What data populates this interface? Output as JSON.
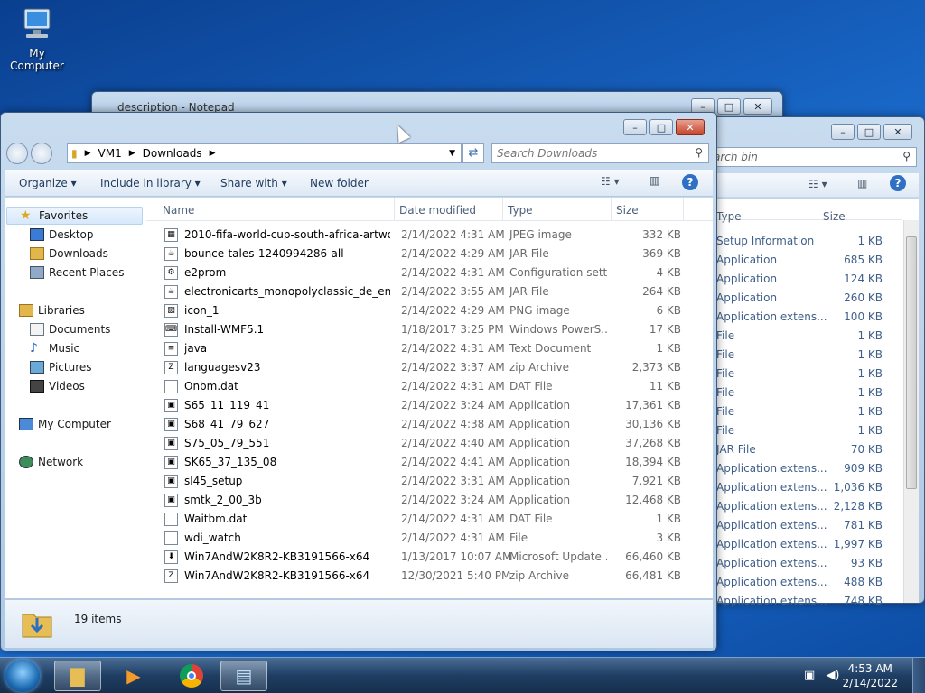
{
  "desktop": {
    "icon_label": "My Computer"
  },
  "notepad": {
    "title": "description - Notepad"
  },
  "bin_window": {
    "search_placeholder": "arch bin",
    "col_type": "Type",
    "col_size": "Size",
    "rows": [
      {
        "type": "Setup Information",
        "size": "1 KB"
      },
      {
        "type": "Application",
        "size": "685 KB"
      },
      {
        "type": "Application",
        "size": "124 KB"
      },
      {
        "type": "Application",
        "size": "260 KB"
      },
      {
        "type": "Application extens...",
        "size": "100 KB"
      },
      {
        "type": "File",
        "size": "1 KB"
      },
      {
        "type": "File",
        "size": "1 KB"
      },
      {
        "type": "File",
        "size": "1 KB"
      },
      {
        "type": "File",
        "size": "1 KB"
      },
      {
        "type": "File",
        "size": "1 KB"
      },
      {
        "type": "File",
        "size": "1 KB"
      },
      {
        "type": "JAR File",
        "size": "70 KB"
      },
      {
        "type": "Application extens...",
        "size": "909 KB"
      },
      {
        "type": "Application extens...",
        "size": "1,036 KB"
      },
      {
        "type": "Application extens...",
        "size": "2,128 KB"
      },
      {
        "type": "Application extens...",
        "size": "781 KB"
      },
      {
        "type": "Application extens...",
        "size": "1,997 KB"
      },
      {
        "type": "Application extens...",
        "size": "93 KB"
      },
      {
        "type": "Application extens...",
        "size": "488 KB"
      },
      {
        "type": "Application extens...",
        "size": "748 KB"
      }
    ]
  },
  "explorer": {
    "breadcrumb": [
      "VM1",
      "Downloads"
    ],
    "search_placeholder": "Search Downloads",
    "toolbar": {
      "organize": "Organize",
      "include": "Include in library",
      "share": "Share with",
      "new_folder": "New folder"
    },
    "columns": {
      "name": "Name",
      "date": "Date modified",
      "type": "Type",
      "size": "Size"
    },
    "nav": {
      "favorites": "Favorites",
      "desktop": "Desktop",
      "downloads": "Downloads",
      "recent": "Recent Places",
      "libraries": "Libraries",
      "documents": "Documents",
      "music": "Music",
      "pictures": "Pictures",
      "videos": "Videos",
      "computer": "My Computer",
      "network": "Network"
    },
    "files": [
      {
        "name": "2010-fifa-world-cup-south-africa-artwor...",
        "date": "2/14/2022 4:31 AM",
        "type": "JPEG image",
        "size": "332 KB",
        "icon": "image-icon"
      },
      {
        "name": "bounce-tales-1240994286-all",
        "date": "2/14/2022 4:29 AM",
        "type": "JAR File",
        "size": "369 KB",
        "icon": "jar-icon"
      },
      {
        "name": "e2prom",
        "date": "2/14/2022 4:31 AM",
        "type": "Configuration sett...",
        "size": "4 KB",
        "icon": "config-icon"
      },
      {
        "name": "electronicarts_monopolyclassic_de_en_es...",
        "date": "2/14/2022 3:55 AM",
        "type": "JAR File",
        "size": "264 KB",
        "icon": "jar-icon"
      },
      {
        "name": "icon_1",
        "date": "2/14/2022 4:29 AM",
        "type": "PNG image",
        "size": "6 KB",
        "icon": "png-icon"
      },
      {
        "name": "Install-WMF5.1",
        "date": "1/18/2017 3:25 PM",
        "type": "Windows PowerS...",
        "size": "17 KB",
        "icon": "script-icon"
      },
      {
        "name": "java",
        "date": "2/14/2022 4:31 AM",
        "type": "Text Document",
        "size": "1 KB",
        "icon": "text-icon"
      },
      {
        "name": "languagesv23",
        "date": "2/14/2022 3:37 AM",
        "type": "zip Archive",
        "size": "2,373 KB",
        "icon": "zip-icon"
      },
      {
        "name": "Onbm.dat",
        "date": "2/14/2022 4:31 AM",
        "type": "DAT File",
        "size": "11 KB",
        "icon": "file-icon"
      },
      {
        "name": "S65_11_119_41",
        "date": "2/14/2022 3:24 AM",
        "type": "Application",
        "size": "17,361 KB",
        "icon": "app-icon"
      },
      {
        "name": "S68_41_79_627",
        "date": "2/14/2022 4:38 AM",
        "type": "Application",
        "size": "30,136 KB",
        "icon": "app-icon"
      },
      {
        "name": "S75_05_79_551",
        "date": "2/14/2022 4:40 AM",
        "type": "Application",
        "size": "37,268 KB",
        "icon": "app-icon"
      },
      {
        "name": "SK65_37_135_08",
        "date": "2/14/2022 4:41 AM",
        "type": "Application",
        "size": "18,394 KB",
        "icon": "app-icon"
      },
      {
        "name": "sl45_setup",
        "date": "2/14/2022 3:31 AM",
        "type": "Application",
        "size": "7,921 KB",
        "icon": "app-icon"
      },
      {
        "name": "smtk_2_00_3b",
        "date": "2/14/2022 3:24 AM",
        "type": "Application",
        "size": "12,468 KB",
        "icon": "app-icon"
      },
      {
        "name": "Waitbm.dat",
        "date": "2/14/2022 4:31 AM",
        "type": "DAT File",
        "size": "1 KB",
        "icon": "file-icon"
      },
      {
        "name": "wdi_watch",
        "date": "2/14/2022 4:31 AM",
        "type": "File",
        "size": "3 KB",
        "icon": "file-icon"
      },
      {
        "name": "Win7AndW2K8R2-KB3191566-x64",
        "date": "1/13/2017 10:07 AM",
        "type": "Microsoft Update ...",
        "size": "66,460 KB",
        "icon": "update-icon"
      },
      {
        "name": "Win7AndW2K8R2-KB3191566-x64",
        "date": "12/30/2021 5:40 PM",
        "type": "zip Archive",
        "size": "66,481 KB",
        "icon": "zip-icon"
      }
    ],
    "item_count": "19 items"
  },
  "taskbar": {
    "time": "4:53 AM",
    "date": "2/14/2022"
  }
}
